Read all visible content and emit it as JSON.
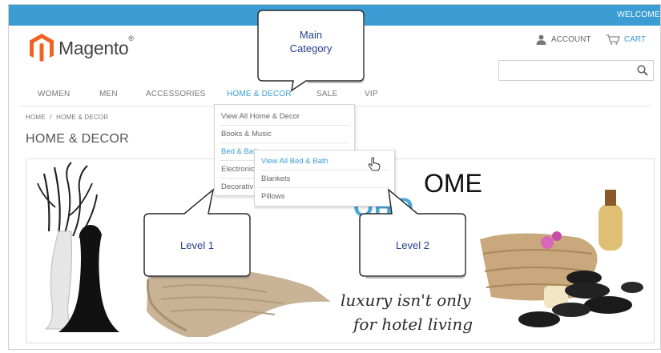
{
  "header": {
    "welcome": "WELCOME"
  },
  "brand": {
    "name": "Magento",
    "reg": "®"
  },
  "top_links": {
    "account": "ACCOUNT",
    "cart": "CART"
  },
  "search": {
    "value": "",
    "placeholder": ""
  },
  "nav": {
    "items": [
      "WOMEN",
      "MEN",
      "ACCESSORIES",
      "HOME & DECOR",
      "SALE",
      "VIP"
    ],
    "active": "HOME & DECOR"
  },
  "breadcrumb": {
    "home": "HOME",
    "separator": "/",
    "current": "HOME & DECOR"
  },
  "page": {
    "title": "HOME & DECOR"
  },
  "dropdown_level1": {
    "items": [
      "View All Home & Decor",
      "Books & Music",
      "Bed & Bath",
      "Electronics",
      "Decorative Accents"
    ],
    "visible_text": [
      "View All Home & Decor",
      "Books & Music",
      "Bed & Bath",
      "Electronic",
      "Decorativ"
    ]
  },
  "dropdown_level2": {
    "items": [
      "View All Bed & Bath",
      "Blankets",
      "Pillows"
    ]
  },
  "banner": {
    "heading_partial": "OME",
    "blue_partial": "OHO",
    "tagline_1": "luxury isn't only",
    "tagline_2": "for hotel living"
  },
  "callouts": {
    "main_category_1": "Main",
    "main_category_2": "Category",
    "level1": "Level 1",
    "level2": "Level 2"
  },
  "colors": {
    "accent": "#3b9dd3",
    "brand_orange": "#f26322",
    "callout_text": "#23408e"
  }
}
